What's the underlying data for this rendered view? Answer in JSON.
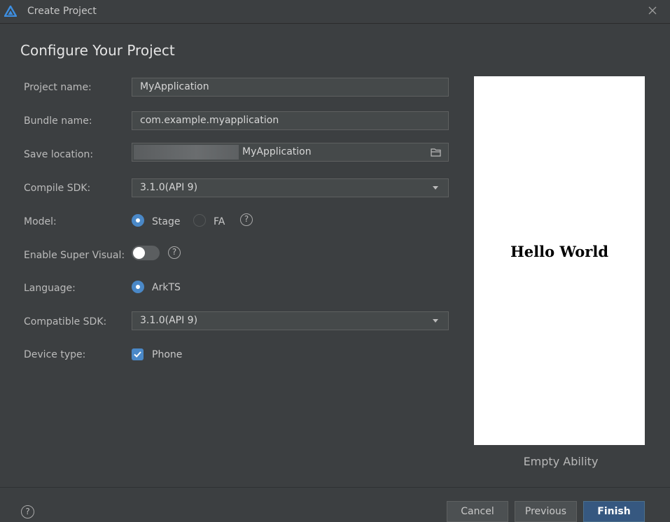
{
  "window": {
    "title": "Create Project"
  },
  "heading": "Configure Your Project",
  "form": {
    "project_name": {
      "label": "Project name:",
      "value": "MyApplication"
    },
    "bundle_name": {
      "label": "Bundle name:",
      "value": "com.example.myapplication"
    },
    "save_location": {
      "label": "Save location:",
      "value": "MyApplication"
    },
    "compile_sdk": {
      "label": "Compile SDK:",
      "value": "3.1.0(API 9)"
    },
    "model": {
      "label": "Model:",
      "options": [
        "Stage",
        "FA"
      ],
      "selected": "Stage"
    },
    "super_visual": {
      "label": "Enable Super Visual:",
      "enabled": false
    },
    "language": {
      "label": "Language:",
      "options": [
        "ArkTS"
      ],
      "selected": "ArkTS"
    },
    "compatible_sdk": {
      "label": "Compatible SDK:",
      "value": "3.1.0(API 9)"
    },
    "device_type": {
      "label": "Device type:",
      "options": [
        "Phone"
      ],
      "checked": [
        "Phone"
      ]
    }
  },
  "preview": {
    "text": "Hello World",
    "template_name": "Empty Ability"
  },
  "footer": {
    "help": "?",
    "cancel": "Cancel",
    "previous": "Previous",
    "finish": "Finish"
  },
  "colors": {
    "accent": "#4a88c7",
    "primary_button": "#365880",
    "background": "#3c3f41"
  }
}
